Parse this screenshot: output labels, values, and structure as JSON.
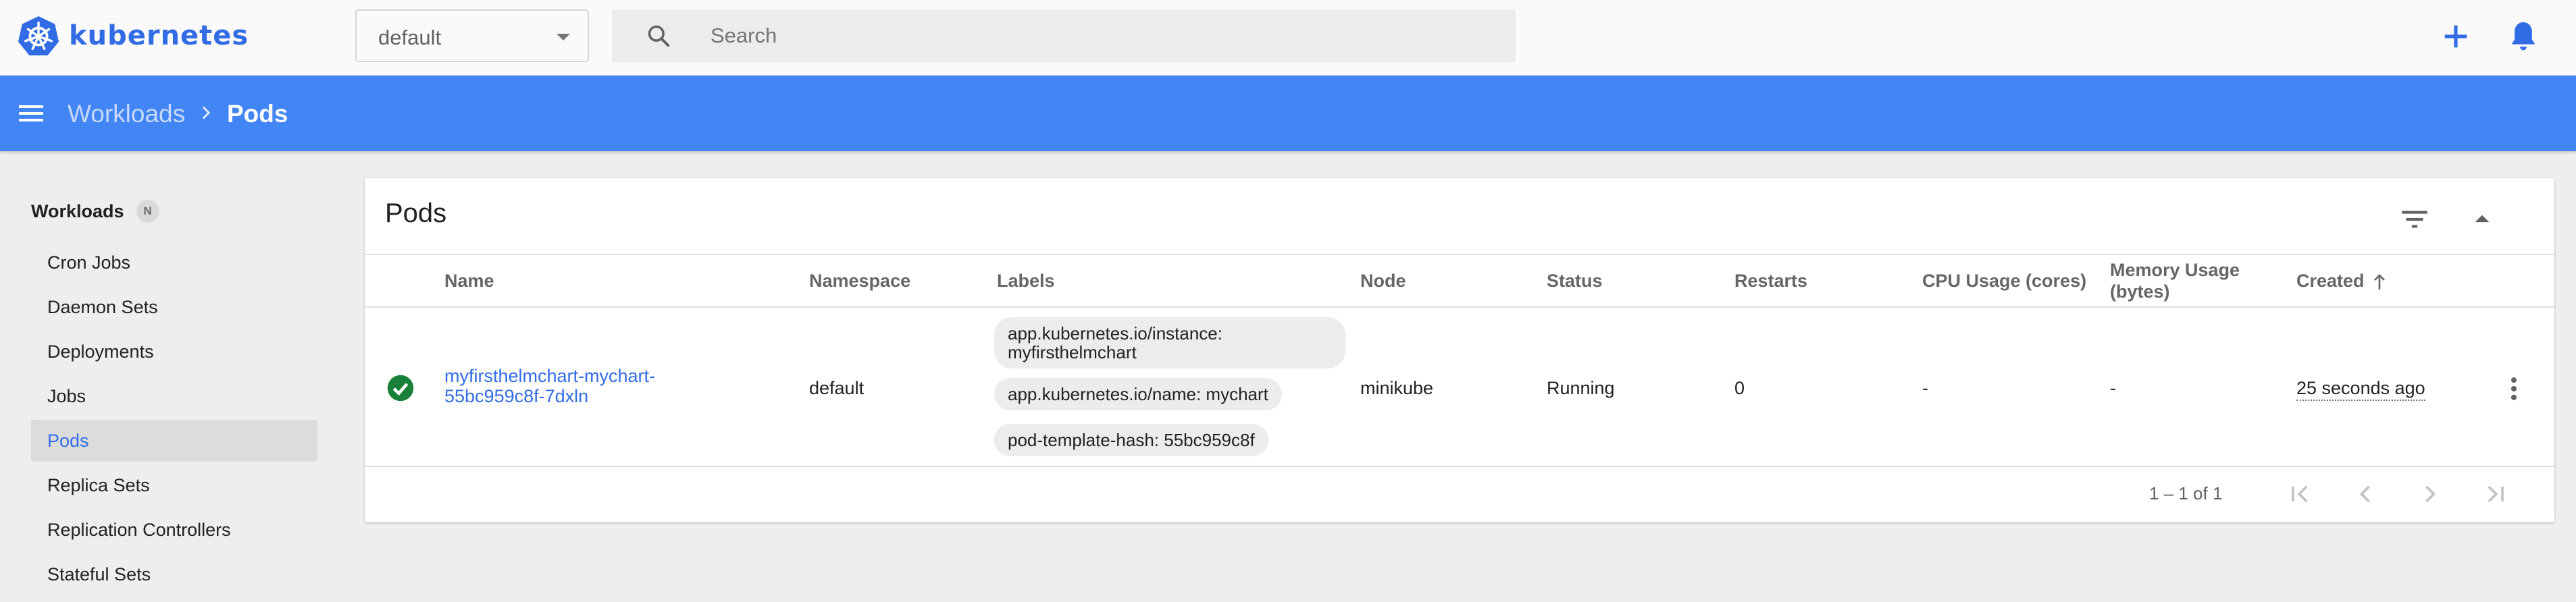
{
  "brand": {
    "name": "kubernetes",
    "color": "#326ce5"
  },
  "namespace": {
    "selected": "default"
  },
  "search": {
    "placeholder": "Search"
  },
  "header_actions": [
    "plus-icon",
    "bell-icon"
  ],
  "breadcrumb": {
    "parent": "Workloads",
    "current": "Pods"
  },
  "sidebar": {
    "title": "Workloads",
    "badge": "N",
    "items": [
      {
        "label": "Cron Jobs",
        "active": false
      },
      {
        "label": "Daemon Sets",
        "active": false
      },
      {
        "label": "Deployments",
        "active": false
      },
      {
        "label": "Jobs",
        "active": false
      },
      {
        "label": "Pods",
        "active": true
      },
      {
        "label": "Replica Sets",
        "active": false
      },
      {
        "label": "Replication Controllers",
        "active": false
      },
      {
        "label": "Stateful Sets",
        "active": false
      }
    ]
  },
  "table": {
    "title": "Pods",
    "columns": {
      "name": "Name",
      "namespace": "Namespace",
      "labels": "Labels",
      "node": "Node",
      "status": "Status",
      "restarts": "Restarts",
      "cpu": "CPU Usage (cores)",
      "memory": "Memory Usage (bytes)",
      "created": "Created"
    },
    "sort": {
      "column": "created",
      "direction": "ascending"
    },
    "rows": [
      {
        "status_icon": "check-circle-icon",
        "status_color": "#188038",
        "name": "myfirsthelmchart-mychart-55bc959c8f-7dxln",
        "namespace": "default",
        "labels": [
          "app.kubernetes.io/instance: myfirsthelmchart",
          "app.kubernetes.io/name: mychart",
          "pod-template-hash: 55bc959c8f"
        ],
        "node": "minikube",
        "status": "Running",
        "restarts": "0",
        "cpu": "-",
        "memory": "-",
        "created": "25 seconds ago"
      }
    ],
    "pagination": {
      "range": "1 – 1 of 1"
    }
  },
  "colors": {
    "accent": "#4285f4",
    "link": "#326ce5",
    "success": "#188038"
  }
}
